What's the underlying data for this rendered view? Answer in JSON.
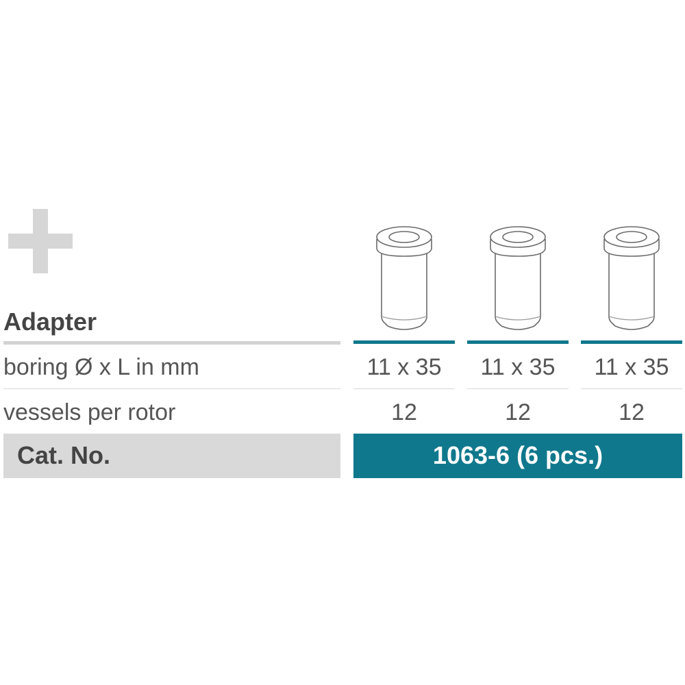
{
  "section_title": "Adapter",
  "rows": [
    {
      "label": "boring Ø x L in mm",
      "values": [
        "11 x 35",
        "11 x 35",
        "11 x 35"
      ]
    },
    {
      "label": "vessels per rotor",
      "values": [
        "12",
        "12",
        "12"
      ]
    }
  ],
  "catalog": {
    "label": "Cat. No.",
    "value": "1063-6 (6 pcs.)"
  },
  "colors": {
    "accent": "#10788c",
    "plus_gray": "#d6d6d6",
    "label_band": "#d9d9d9"
  },
  "icons": [
    "plus-icon",
    "adapter-icon"
  ]
}
